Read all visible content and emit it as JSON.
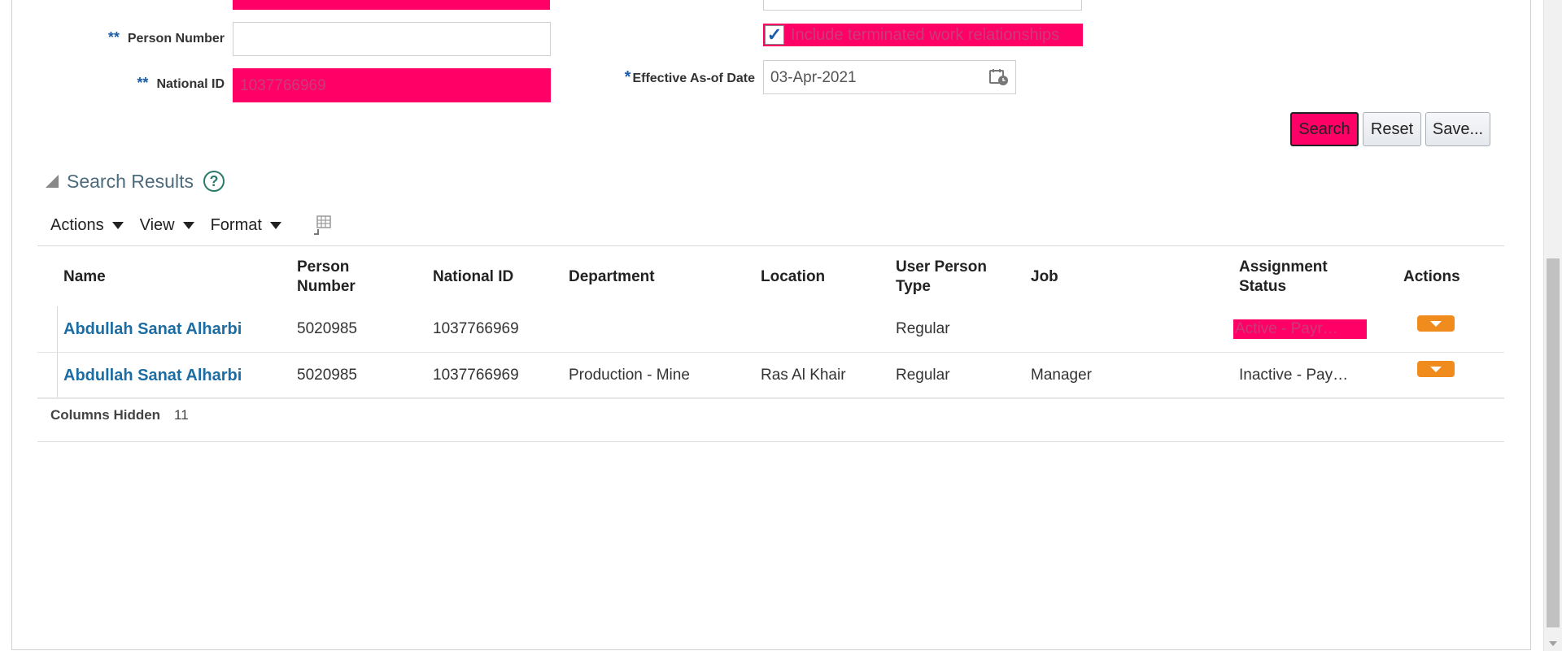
{
  "form": {
    "person_number_label": "Person Number",
    "person_number_value": "",
    "national_id_label": "National ID",
    "national_id_value": "1037766969",
    "required_marker": "**",
    "include_terminated_label": "Include terminated work relationships",
    "include_terminated_checked": true,
    "effective_date_marker": "*",
    "effective_date_label": "Effective As-of Date",
    "effective_date_value": "03-Apr-2021"
  },
  "buttons": {
    "search": "Search",
    "reset": "Reset",
    "save": "Save..."
  },
  "results": {
    "title": "Search Results",
    "help": "?",
    "toolbar": {
      "actions": "Actions",
      "view": "View",
      "format": "Format"
    },
    "columns": [
      "Name",
      "Person Number",
      "National ID",
      "Department",
      "Location",
      "User Person Type",
      "Job",
      "Assignment Status",
      "Actions"
    ],
    "column_lines": {
      "person_number": [
        "Person",
        "Number"
      ],
      "user_person_type": [
        "User Person",
        "Type"
      ],
      "assignment_status": [
        "Assignment",
        "Status"
      ]
    },
    "rows": [
      {
        "name": "Abdullah Sanat Alharbi",
        "person_number": "5020985",
        "national_id": "1037766969",
        "department": "",
        "location": "",
        "user_person_type": "Regular",
        "job": "",
        "assignment_status": "Active - Payr…"
      },
      {
        "name": "Abdullah Sanat Alharbi",
        "person_number": "5020985",
        "national_id": "1037766969",
        "department": "Production - Mine",
        "location": "Ras Al Khair",
        "user_person_type": "Regular",
        "job": "Manager",
        "assignment_status": "Inactive - Pay…"
      }
    ],
    "columns_hidden_label": "Columns Hidden",
    "columns_hidden_count": "11"
  },
  "colors": {
    "highlight": "#ff0066",
    "link": "#1c6da3",
    "action_button": "#f08c1e"
  }
}
